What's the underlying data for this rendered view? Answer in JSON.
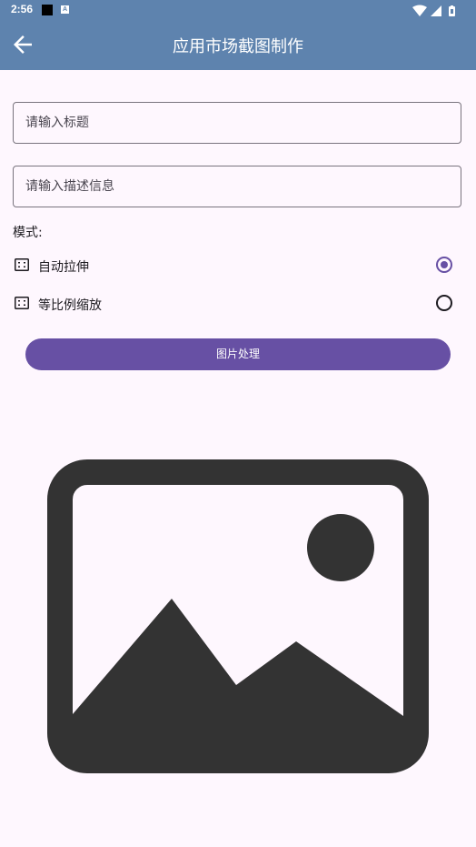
{
  "status_bar": {
    "time": "2:56",
    "icons": [
      "notification-square-icon",
      "a-icon",
      "wifi-icon",
      "signal-icon",
      "battery-icon"
    ],
    "a_glyph": "A"
  },
  "app_bar": {
    "title": "应用市场截图制作",
    "back_icon": "arrow-back-icon"
  },
  "form": {
    "title_placeholder": "请输入标题",
    "title_value": "",
    "desc_placeholder": "请输入描述信息",
    "desc_value": ""
  },
  "mode": {
    "label": "模式:",
    "options": [
      {
        "label": "自动拉伸",
        "selected": true,
        "icon": "aspect-ratio-icon"
      },
      {
        "label": "等比例缩放",
        "selected": false,
        "icon": "aspect-ratio-icon"
      }
    ]
  },
  "process_button": {
    "label": "图片处理"
  },
  "preview": {
    "icon": "image-placeholder-icon"
  },
  "colors": {
    "app_bar": "#5E83AE",
    "primary": "#6750A4",
    "background": "#FEF7FE",
    "image_placeholder": "#333333"
  }
}
